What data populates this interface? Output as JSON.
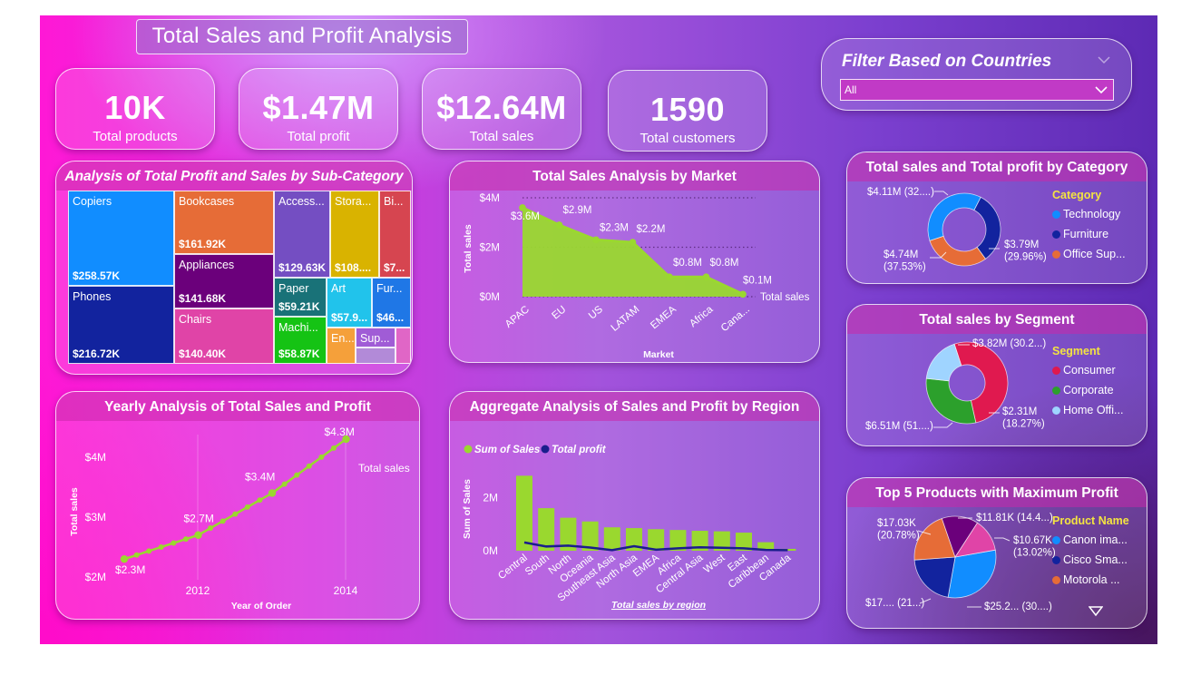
{
  "page_title": "Total Sales and Profit Analysis",
  "kpis": [
    {
      "value": "10K",
      "label": "Total products"
    },
    {
      "value": "$1.47M",
      "label": "Total profit"
    },
    {
      "value": "$12.64M",
      "label": "Total sales"
    },
    {
      "value": "1590",
      "label": "Total customers"
    }
  ],
  "filter": {
    "title": "Filter Based on Countries",
    "selected": "All"
  },
  "colors": {
    "green": "#9ad82f",
    "navy": "#1a1e8c",
    "legend_title": "#f4e441",
    "header": "#c828aa"
  },
  "treemap": {
    "title": "Analysis of Total Profit and Sales by Sub-Category",
    "cells": [
      {
        "name": "Copiers",
        "value": "$258.57K",
        "color": "#118dff"
      },
      {
        "name": "Phones",
        "value": "$216.72K",
        "color": "#12239e"
      },
      {
        "name": "Bookcases",
        "value": "$161.92K",
        "color": "#e66c37"
      },
      {
        "name": "Appliances",
        "value": "$141.68K",
        "color": "#6b007b"
      },
      {
        "name": "Chairs",
        "value": "$140.40K",
        "color": "#e044a7"
      },
      {
        "name": "Access...",
        "value": "$129.63K",
        "color": "#744ec2"
      },
      {
        "name": "Paper",
        "value": "$59.21K",
        "color": "#197278"
      },
      {
        "name": "Machi...",
        "value": "$58.87K",
        "color": "#15c314"
      },
      {
        "name": "Stora...",
        "value": "$108....",
        "color": "#d9b300"
      },
      {
        "name": "Art",
        "value": "$57.9...",
        "color": "#21c3eb"
      },
      {
        "name": "En...",
        "value": "",
        "color": "#f5a03a"
      },
      {
        "name": "Bi...",
        "value": "$7...",
        "color": "#d64550"
      },
      {
        "name": "Fur...",
        "value": "$46...",
        "color": "#1f77e6"
      },
      {
        "name": "Sup...",
        "value": "",
        "color": "#a05cd6"
      },
      {
        "name": "",
        "value": "",
        "color": "#e066c6"
      },
      {
        "name": "",
        "value": "",
        "color": "#b28ad8"
      }
    ]
  },
  "chart_data": [
    {
      "type": "area",
      "title": "Total Sales Analysis by Market",
      "xlabel": "Market",
      "ylabel": "Total sales",
      "categories": [
        "APAC",
        "EU",
        "US",
        "LATAM",
        "EMEA",
        "Africa",
        "Cana..."
      ],
      "values": [
        3.6,
        2.9,
        2.3,
        2.2,
        0.8,
        0.8,
        0.1
      ],
      "data_labels": [
        "$3.6M",
        "$2.9M",
        "$2.3M",
        "$2.2M",
        "$0.8M",
        "$0.8M",
        "$0.1M"
      ],
      "yticks": [
        "$0M",
        "$2M",
        "$4M"
      ],
      "ylim": [
        0,
        4
      ],
      "series": [
        {
          "name": "Total sales",
          "values": [
            3.6,
            2.9,
            2.3,
            2.2,
            0.8,
            0.8,
            0.1
          ]
        }
      ]
    },
    {
      "type": "line",
      "title": "Yearly Analysis of Total Sales and Profit",
      "xlabel": "Year of Order",
      "ylabel": "Total sales",
      "x": [
        2011,
        2012,
        2013,
        2014
      ],
      "values": [
        2.3,
        2.7,
        3.4,
        4.3
      ],
      "data_labels": [
        "$2.3M",
        "$2.7M",
        "$3.4M",
        "$4.3M"
      ],
      "xticks": [
        "2012",
        "2014"
      ],
      "yticks": [
        "$2M",
        "$3M",
        "$4M"
      ],
      "ylim": [
        2,
        4.3
      ],
      "series": [
        {
          "name": "Total sales",
          "values": [
            2.3,
            2.7,
            3.4,
            4.3
          ]
        }
      ]
    },
    {
      "type": "bar",
      "title": "Aggregate Analysis of Sales and Profit by Region",
      "xlabel": "Total sales by region",
      "ylabel": "Sum of Sales",
      "categories": [
        "Central",
        "South",
        "North",
        "Oceania",
        "Southeast Asia",
        "North Asia",
        "EMEA",
        "Africa",
        "Central Asia",
        "West",
        "East",
        "Caribbean",
        "Canada"
      ],
      "yticks": [
        "0M",
        "2M"
      ],
      "ylim": [
        0,
        2.9
      ],
      "series": [
        {
          "name": "Sum of Sales",
          "values": [
            2.82,
            1.6,
            1.24,
            1.1,
            0.88,
            0.85,
            0.81,
            0.78,
            0.75,
            0.73,
            0.68,
            0.32,
            0.07
          ]
        },
        {
          "name": "Total profit",
          "values": [
            0.31,
            0.16,
            0.19,
            0.12,
            0.02,
            0.17,
            0.04,
            0.09,
            0.13,
            0.11,
            0.09,
            0.03,
            0.02
          ]
        }
      ]
    },
    {
      "type": "pie",
      "title": "Total sales and Total profit by Category",
      "legend_title": "Category",
      "slices": [
        {
          "name": "Technology",
          "value": 37.53,
          "label": "$4.74M\n(37.53%)",
          "color": "#118dff"
        },
        {
          "name": "Furniture",
          "value": 32.51,
          "label": "$4.11M (32....)",
          "color": "#12239e"
        },
        {
          "name": "Office Sup...",
          "value": 29.96,
          "label": "$3.79M\n(29.96%)",
          "color": "#e66c37"
        }
      ]
    },
    {
      "type": "pie",
      "title": "Total sales by Segment",
      "legend_title": "Segment",
      "slices": [
        {
          "name": "Consumer",
          "value": 51.5,
          "label": "$6.51M (51....)",
          "color": "#e0194f"
        },
        {
          "name": "Corporate",
          "value": 30.23,
          "label": "$3.82M (30.2...)",
          "color": "#2ca02c"
        },
        {
          "name": "Home Offi...",
          "value": 18.27,
          "label": "$2.31M\n(18.27%)",
          "color": "#9fd4ff"
        }
      ]
    },
    {
      "type": "pie",
      "title": "Top 5 Products with Maximum Profit",
      "legend_title": "Product Name",
      "slices": [
        {
          "name": "Canon ima...",
          "value": 30.5,
          "label": "$25.2... (30....)",
          "color": "#118dff"
        },
        {
          "name": "Cisco Sma...",
          "value": 21.0,
          "label": "$17.... (21...)",
          "color": "#12239e"
        },
        {
          "name": "Motorola ...",
          "value": 20.78,
          "label": "$17.03K\n(20.78%)",
          "color": "#e66c37"
        },
        {
          "name": "",
          "value": 14.4,
          "label": "$11.81K (14.4...)",
          "color": "#6b007b"
        },
        {
          "name": "",
          "value": 13.02,
          "label": "$10.67K\n(13.02%)",
          "color": "#e044a7"
        }
      ]
    }
  ]
}
